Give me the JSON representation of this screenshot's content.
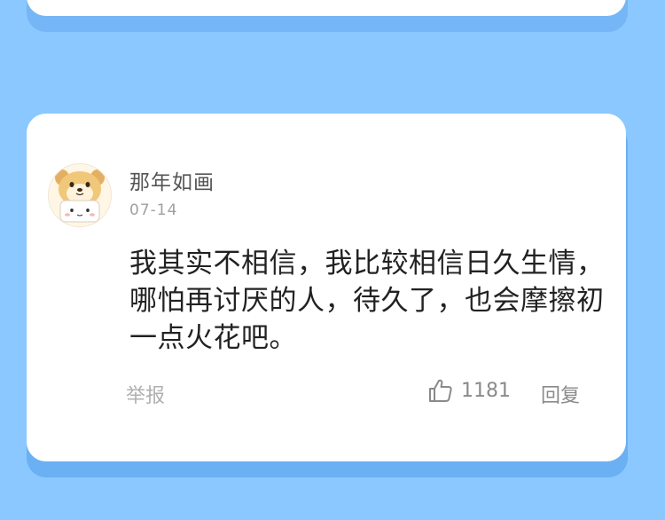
{
  "comment": {
    "username": "那年如画",
    "date": "07-14",
    "text": "我其实不相信，我比较相信日久生情，哪怕再讨厌的人，待久了，也会摩擦初一点火花吧。",
    "report_label": "举报",
    "like_count": "1181",
    "reply_label": "回复",
    "like_icon": "thumbs-up-icon",
    "avatar_icon": "dog-avatar-icon"
  },
  "colors": {
    "background": "#8ac8ff",
    "card": "#ffffff",
    "card_shadow": "#6ab0f3"
  }
}
